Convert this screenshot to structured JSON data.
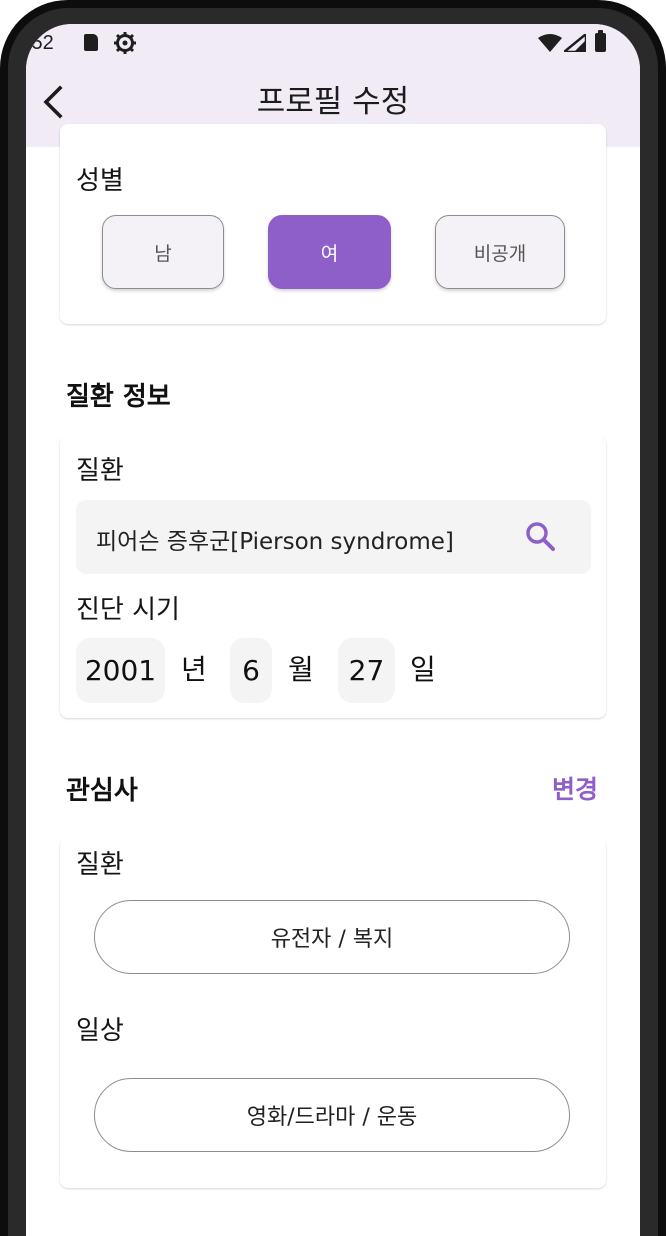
{
  "status_bar": {
    "time": ":52",
    "icons": [
      "sd-card-icon",
      "gear-icon",
      "wifi-icon",
      "signal-icon",
      "battery-icon"
    ]
  },
  "app_bar": {
    "title": "프로필 수정",
    "back_icon": "chevron-left-icon"
  },
  "gender": {
    "label": "성별",
    "options": [
      "남",
      "여",
      "비공개"
    ],
    "selected": "여"
  },
  "disease_info": {
    "section_title": "질환 정보",
    "disease_label": "질환",
    "disease_value": "피어슨 증후군[Pierson syndrome]",
    "diagnosis_label": "진단 시기",
    "year": "2001",
    "year_unit": "년",
    "month": "6",
    "month_unit": "월",
    "day": "27",
    "day_unit": "일"
  },
  "interests": {
    "section_title": "관심사",
    "change_label": "변경",
    "disease_label": "질환",
    "disease_value": "유전자 / 복지",
    "daily_label": "일상",
    "daily_value": "영화/드라마 / 운동"
  },
  "colors": {
    "accent": "#8e5ec9",
    "app_bar_bg": "#f1ebf5"
  }
}
